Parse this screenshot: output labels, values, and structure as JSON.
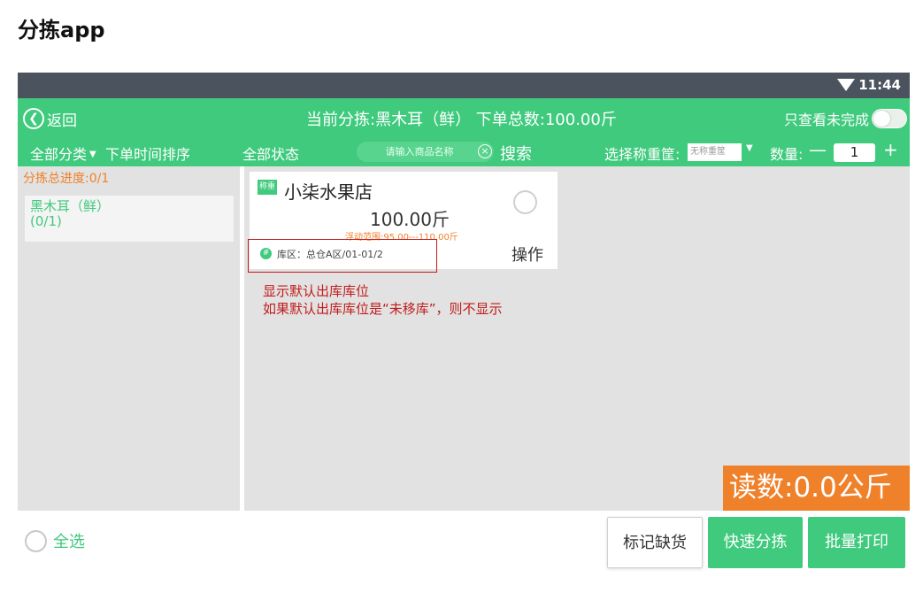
{
  "doc_title": "分拣app",
  "statusbar": {
    "time": "11:44"
  },
  "topbar": {
    "back_label": "返回",
    "current_sorting": "当前分拣:黑木耳（鲜）  下单总数:100.00斤",
    "only_unfinished_label": "只查看未完成"
  },
  "filters": {
    "all_categories": "全部分类",
    "order_time_sort": "下单时间排序",
    "all_status": "全部状态",
    "search_placeholder": "请输入商品名称",
    "search_button": "搜索",
    "scale_label": "选择称重筐:",
    "scale_value": "无称重筐",
    "qty_label": "数量:",
    "qty_value": "1"
  },
  "sidebar": {
    "progress": "分拣总进度:0/1",
    "items": [
      {
        "name": "黑木耳（鲜）",
        "count": "(0/1)"
      }
    ]
  },
  "card": {
    "badge": "称重",
    "shop_name": "小柒水果店",
    "weight": "100.00斤",
    "float_range": "浮动范围:95.00---110.00斤",
    "location": "库区：总仓A区/01-01/2",
    "action": "操作"
  },
  "annotation": {
    "line1": "显示默认出库库位",
    "line2": "如果默认出库库位是“未移库”，则不显示"
  },
  "reading": "读数:0.0公斤",
  "bottom": {
    "select_all": "全选",
    "mark_shortage": "标记缺货",
    "quick_sort": "快速分拣",
    "batch_print": "批量打印"
  },
  "colors": {
    "brand_green": "#3fca7d",
    "accent_orange": "#f0812b",
    "annotation_red": "#c11b1b",
    "statusbar": "#4a535e"
  },
  "icons": [
    "wifi-icon",
    "back-icon",
    "toggle-switch",
    "clear-icon",
    "caret-down-icon",
    "location-pin-icon",
    "radio-icon"
  ]
}
